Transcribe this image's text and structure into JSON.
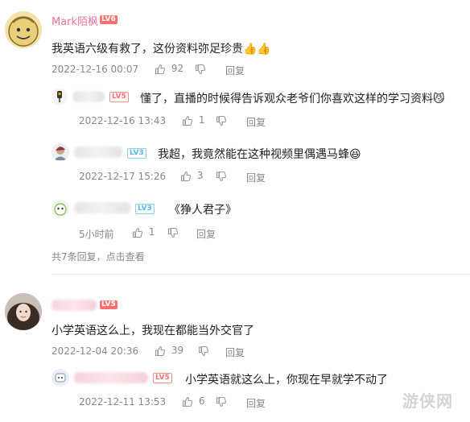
{
  "thread1": {
    "comment": {
      "username": "Mark陌枫",
      "level": "LV6",
      "text": "我英语六级有救了，这份资料弥足珍贵",
      "emoji": "👍👍",
      "date": "2022-12-16 00:07",
      "likes": "92",
      "reply_label": "回复"
    },
    "replies": [
      {
        "level": "LV5",
        "text": "懂了，直播的时候得告诉观众老爷们你喜欢这样的学习资料",
        "emoji": "😼",
        "date": "2022-12-16 13:43",
        "likes": "1",
        "reply_label": "回复"
      },
      {
        "level": "LV3",
        "text": "我超，我竟然能在这种视频里偶遇马蜂",
        "emoji": "😆",
        "date": "2022-12-17 15:26",
        "likes": "3",
        "reply_label": "回复"
      },
      {
        "level": "LV3",
        "text": "《狰人君子》",
        "date": "5小时前",
        "likes": "1",
        "reply_label": "回复"
      }
    ],
    "more_replies": "共7条回复，点击查看"
  },
  "thread2": {
    "comment": {
      "level": "LV5",
      "text": "小学英语这么上，我现在都能当外交官了",
      "date": "2022-12-04 20:36",
      "likes": "39",
      "reply_label": "回复"
    },
    "replies": [
      {
        "level": "LV5",
        "text": "小学英语就这么上，你现在早就学不动了",
        "date": "2022-12-11 13:53",
        "likes": "6",
        "reply_label": "回复"
      }
    ]
  },
  "watermark": "游侠网",
  "colors": {
    "username": "#fb7299",
    "level_badge": "#ff6f6f",
    "meta": "#888888"
  }
}
